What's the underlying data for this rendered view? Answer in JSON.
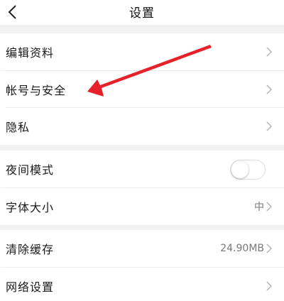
{
  "header": {
    "title": "设置",
    "back_icon": "chevron-left-icon"
  },
  "groups": [
    {
      "items": [
        {
          "label": "编辑资料",
          "type": "nav"
        },
        {
          "label": "帐号与安全",
          "type": "nav"
        },
        {
          "label": "隐私",
          "type": "nav"
        }
      ]
    },
    {
      "items": [
        {
          "label": "夜间模式",
          "type": "toggle",
          "on": false
        },
        {
          "label": "字体大小",
          "type": "nav",
          "value": "中"
        }
      ]
    },
    {
      "items": [
        {
          "label": "清除缓存",
          "type": "nav",
          "value": "24.90MB"
        },
        {
          "label": "网络设置",
          "type": "nav"
        }
      ]
    }
  ],
  "colors": {
    "background": "#f2f2f2",
    "row": "#ffffff",
    "arrow": "#e6212a"
  }
}
